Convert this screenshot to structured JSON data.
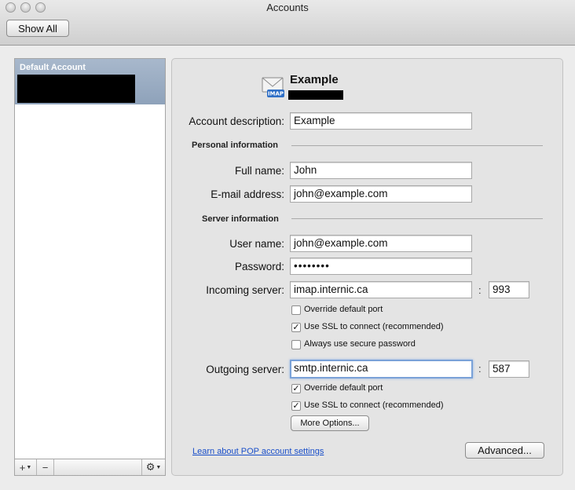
{
  "window": {
    "title": "Accounts"
  },
  "toolbar": {
    "show_all_label": "Show All"
  },
  "sidebar": {
    "header": "Default Account",
    "add_label": "+",
    "remove_label": "−"
  },
  "account": {
    "name": "Example",
    "type_badge": "IMAP",
    "description_label": "Account description:",
    "description_value": "Example"
  },
  "personal": {
    "section_title": "Personal information",
    "full_name_label": "Full name:",
    "full_name_value": "John",
    "email_label": "E-mail address:",
    "email_value": "john@example.com"
  },
  "server": {
    "section_title": "Server information",
    "username_label": "User name:",
    "username_value": "john@example.com",
    "password_label": "Password:",
    "password_value": "••••••••",
    "incoming_label": "Incoming server:",
    "incoming_value": "imap.internic.ca",
    "incoming_port": "993",
    "incoming_override_label": "Override default port",
    "incoming_override_checked": false,
    "incoming_ssl_label": "Use SSL to connect (recommended)",
    "incoming_ssl_checked": true,
    "incoming_secure_pw_label": "Always use secure password",
    "incoming_secure_pw_checked": false,
    "outgoing_label": "Outgoing server:",
    "outgoing_value": "smtp.internic.ca",
    "outgoing_port": "587",
    "outgoing_override_label": "Override default port",
    "outgoing_override_checked": true,
    "outgoing_ssl_label": "Use SSL to connect (recommended)",
    "outgoing_ssl_checked": true,
    "more_options_label": "More Options..."
  },
  "footer": {
    "learn_link": "Learn about POP account settings",
    "advanced_label": "Advanced..."
  },
  "colors": {
    "selection": "#9aacc2",
    "link": "#1a4fc9",
    "focus_ring": "#7aa2d8"
  },
  "icons": {
    "account": "mail-envelope-icon",
    "gear": "gear-icon"
  }
}
